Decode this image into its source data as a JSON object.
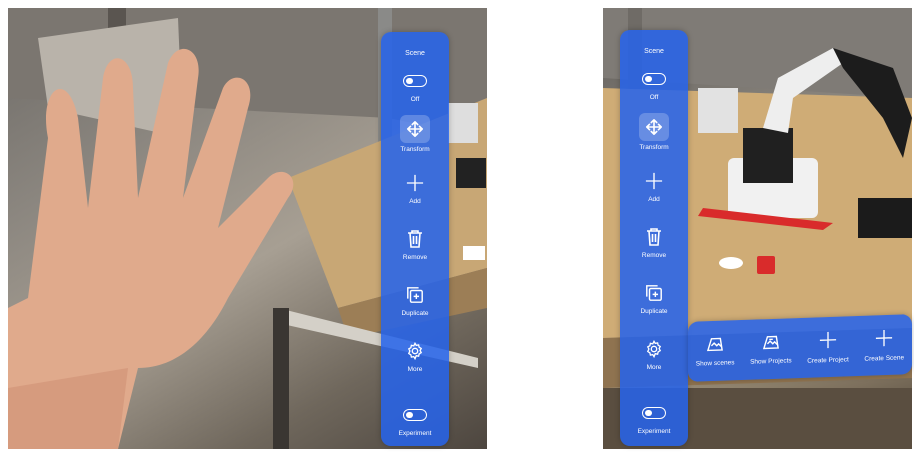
{
  "panel_left": {
    "title": "Scene",
    "buttons": [
      {
        "label": "Off",
        "icon": "toggle-icon"
      },
      {
        "label": "Transform",
        "icon": "move-arrows-icon"
      },
      {
        "label": "Add",
        "icon": "plus-icon"
      },
      {
        "label": "Remove",
        "icon": "trash-icon"
      },
      {
        "label": "Duplicate",
        "icon": "duplicate-icon"
      },
      {
        "label": "More",
        "icon": "gear-icon"
      },
      {
        "label": "Experiment",
        "icon": "toggle-icon"
      }
    ]
  },
  "panel_right": {
    "title": "Scene",
    "buttons": [
      {
        "label": "Off",
        "icon": "toggle-icon"
      },
      {
        "label": "Transform",
        "icon": "move-arrows-icon"
      },
      {
        "label": "Add",
        "icon": "plus-icon"
      },
      {
        "label": "Remove",
        "icon": "trash-icon"
      },
      {
        "label": "Duplicate",
        "icon": "duplicate-icon"
      },
      {
        "label": "More",
        "icon": "gear-icon"
      },
      {
        "label": "Experiment",
        "icon": "toggle-icon"
      }
    ]
  },
  "submenu": {
    "buttons": [
      {
        "label": "Show scenes",
        "icon": "scenes-icon"
      },
      {
        "label": "Show Projects",
        "icon": "projects-icon"
      },
      {
        "label": "Create Project",
        "icon": "plus-icon"
      },
      {
        "label": "Create Scene",
        "icon": "plus-icon"
      }
    ]
  },
  "colors": {
    "panel": "#2563eb",
    "panel_text": "#ffffff",
    "robot_marker": "#d92b2b"
  }
}
